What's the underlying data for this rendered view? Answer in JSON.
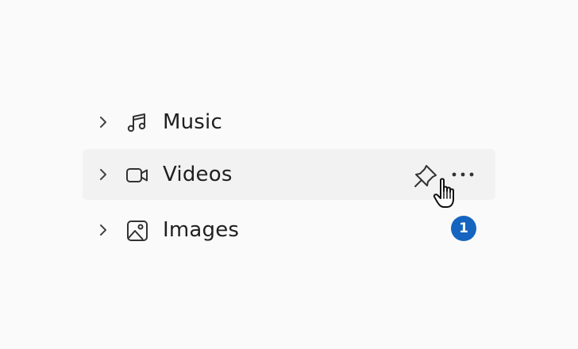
{
  "tree": {
    "items": [
      {
        "label": "Music",
        "icon": "music-note-icon",
        "expanded": false,
        "hovered": false
      },
      {
        "label": "Videos",
        "icon": "video-camera-icon",
        "expanded": false,
        "hovered": true,
        "actions": {
          "pin_icon": "pin-icon",
          "more_icon": "more-horizontal-icon"
        }
      },
      {
        "label": "Images",
        "icon": "image-icon",
        "expanded": false,
        "hovered": false,
        "badge": "1"
      }
    ]
  },
  "colors": {
    "background": "#fafafa",
    "hover_background": "#f2f2f2",
    "text": "#1f1f1f",
    "badge": "#1565c0"
  },
  "cursor": "hand-pointer-icon"
}
